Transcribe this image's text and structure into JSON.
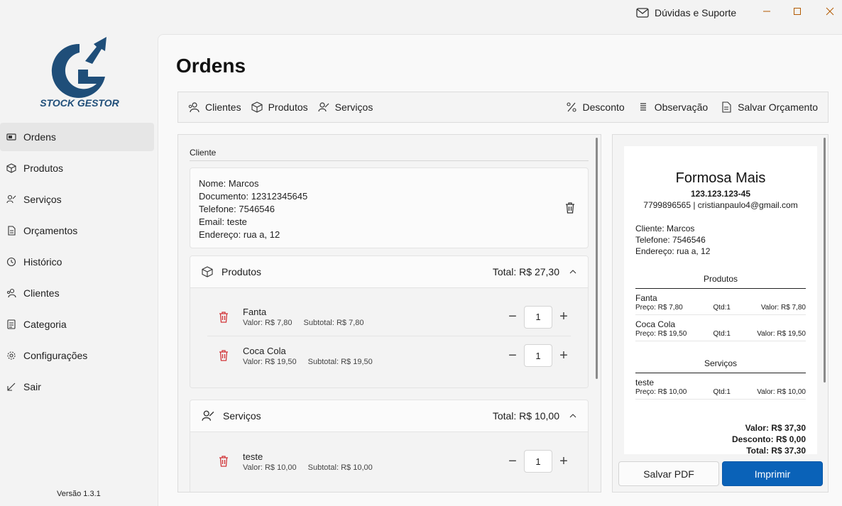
{
  "window": {
    "support_label": "Dúvidas e Suporte",
    "icons": [
      "mail-icon",
      "minimize-icon",
      "maximize-icon",
      "close-icon"
    ]
  },
  "sidebar": {
    "brand": "STOCK GESTOR",
    "items": [
      {
        "label": "Ordens",
        "icon": "orders-icon"
      },
      {
        "label": "Produtos",
        "icon": "box-icon"
      },
      {
        "label": "Serviços",
        "icon": "service-icon"
      },
      {
        "label": "Orçamentos",
        "icon": "budget-icon"
      },
      {
        "label": "Histórico",
        "icon": "clock-icon"
      },
      {
        "label": "Clientes",
        "icon": "clients-icon"
      },
      {
        "label": "Categoria",
        "icon": "category-icon"
      },
      {
        "label": "Configurações",
        "icon": "gear-icon"
      },
      {
        "label": "Sair",
        "icon": "exit-icon"
      }
    ],
    "version": "Versão 1.3.1"
  },
  "main": {
    "title": "Ordens",
    "toolbar": {
      "clientes": "Clientes",
      "produtos": "Produtos",
      "servicos": "Serviços",
      "desconto": "Desconto",
      "observacao": "Observação",
      "salvar": "Salvar Orçamento"
    },
    "client_section": {
      "label": "Cliente",
      "nome": "Nome: Marcos",
      "documento": "Documento: 12312345645",
      "telefone": "Telefone: 7546546",
      "email": "Email: teste",
      "endereco": "Endereço: rua a, 12"
    },
    "produtos": {
      "title": "Produtos",
      "total": "Total: R$ 27,30",
      "items": [
        {
          "name": "Fanta",
          "valor": "Valor: R$ 7,80",
          "subtotal": "Subtotal: R$ 7,80",
          "qty": "1"
        },
        {
          "name": "Coca Cola",
          "valor": "Valor: R$ 19,50",
          "subtotal": "Subtotal: R$ 19,50",
          "qty": "1"
        }
      ]
    },
    "servicos": {
      "title": "Serviços",
      "total": "Total: R$ 10,00",
      "items": [
        {
          "name": "teste",
          "valor": "Valor: R$ 10,00",
          "subtotal": "Subtotal: R$ 10,00",
          "qty": "1"
        }
      ]
    }
  },
  "receipt": {
    "company": "Formosa Mais",
    "doc": "123.123.123-45",
    "contact": "7799896565 | cristianpaulo4@gmail.com",
    "cliente": "Cliente: Marcos",
    "telefone": "Telefone: 7546546",
    "endereco": "Endereço: rua a, 12",
    "produtos_title": "Produtos",
    "produtos": [
      {
        "name": "Fanta",
        "preco": "Preço: R$ 7,80",
        "qtd": "Qtd:1",
        "valor": "Valor: R$ 7,80"
      },
      {
        "name": "Coca Cola",
        "preco": "Preço: R$ 19,50",
        "qtd": "Qtd:1",
        "valor": "Valor: R$ 19,50"
      }
    ],
    "servicos_title": "Serviços",
    "servicos": [
      {
        "name": "teste",
        "preco": "Preço: R$ 10,00",
        "qtd": "Qtd:1",
        "valor": "Valor: R$ 10,00"
      }
    ],
    "valor": "Valor: R$ 37,30",
    "desconto": "Desconto: R$ 0,00",
    "total": "Total: R$ 37,30",
    "btn_pdf": "Salvar PDF",
    "btn_print": "Imprimir"
  },
  "colors": {
    "accent": "#0a62b8",
    "logo": "#1f4e79",
    "danger": "#d13438"
  }
}
